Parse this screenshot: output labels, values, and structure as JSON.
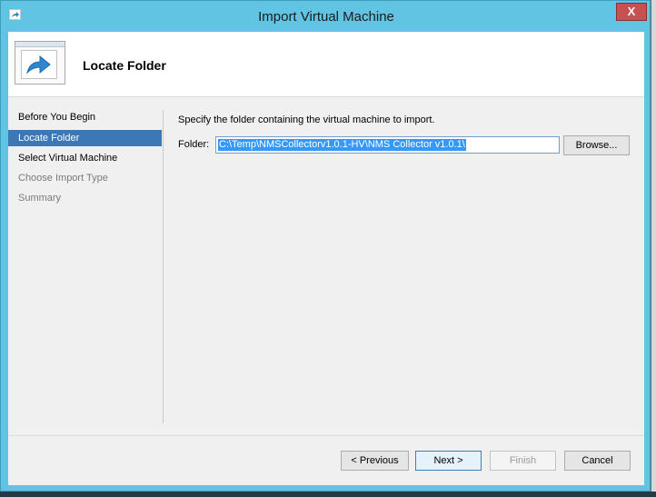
{
  "window": {
    "title": "Import Virtual Machine",
    "close_glyph": "X"
  },
  "header": {
    "title": "Locate Folder",
    "icon": "import-arrow-icon"
  },
  "nav": {
    "items": [
      {
        "label": "Before You Begin",
        "state": "normal"
      },
      {
        "label": "Locate Folder",
        "state": "selected"
      },
      {
        "label": "Select Virtual Machine",
        "state": "normal"
      },
      {
        "label": "Choose Import Type",
        "state": "disabled"
      },
      {
        "label": "Summary",
        "state": "disabled"
      }
    ]
  },
  "main": {
    "instructions": "Specify the folder containing the virtual machine to import.",
    "folder_label": "Folder:",
    "folder_value": "C:\\Temp\\NMSCollectorv1.0.1-HV\\NMS Collector v1.0.1\\",
    "browse_label": "Browse..."
  },
  "footer": {
    "previous_label": "< Previous",
    "next_label": "Next >",
    "finish_label": "Finish",
    "cancel_label": "Cancel"
  },
  "colors": {
    "titlebar": "#62c4e3",
    "close_button": "#c75050",
    "nav_selected": "#3c78b5",
    "selection_highlight": "#3399ff"
  }
}
